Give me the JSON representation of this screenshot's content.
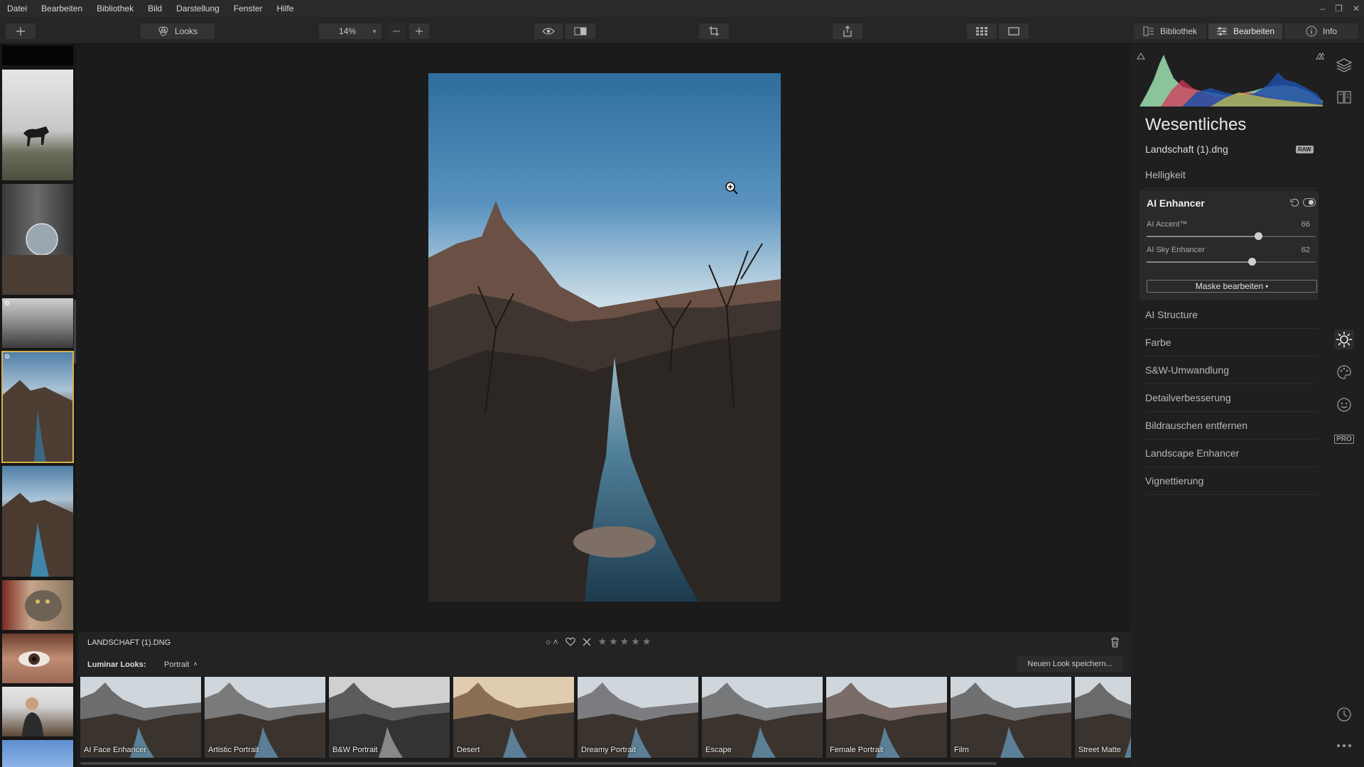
{
  "menu": [
    "Datei",
    "Bearbeiten",
    "Bibliothek",
    "Bild",
    "Darstellung",
    "Fenster",
    "Hilfe"
  ],
  "toolbar": {
    "looks_label": "Looks",
    "zoom_value": "14%",
    "tab_library": "Bibliothek",
    "tab_edit": "Bearbeiten",
    "tab_info": "Info"
  },
  "image": {
    "filename_caps": "LANDSCHAFT (1).DNG"
  },
  "looks": {
    "label": "Luminar Looks:",
    "category": "Portrait",
    "save_button": "Neuen Look speichern...",
    "items": [
      "AI Face Enhancer",
      "Artistic Portrait",
      "B&W Portrait",
      "Desert",
      "Dreamy Portrait",
      "Escape",
      "Female Portrait",
      "Film",
      "Street Matte"
    ]
  },
  "panel": {
    "title": "Wesentliches",
    "filename": "Landschaft (1).dng",
    "raw_badge": "RAW",
    "helligkeit": "Helligkeit",
    "ai_enhancer": {
      "title": "AI Enhancer",
      "accent_label": "AI Accent™",
      "accent_value": "66",
      "accent_fraction": 0.66,
      "sky_label": "AI Sky Enhancer",
      "sky_value": "62",
      "sky_fraction": 0.62,
      "mask_button": "Maske bearbeiten"
    },
    "sections": [
      "AI Structure",
      "Farbe",
      "S&W-Umwandlung",
      "Detailverbesserung",
      "Bildrauschen entfernen",
      "Landscape Enhancer",
      "Vignettierung"
    ]
  },
  "rail": {
    "pro_badge": "PRO"
  },
  "icons": [
    "plus-icon",
    "looks-icon",
    "minus-icon",
    "eye-icon",
    "compare-icon",
    "crop-icon",
    "share-icon",
    "grid-icon",
    "single-view-icon",
    "library-icon",
    "sliders-icon",
    "info-icon",
    "layers-icon",
    "canvas-icon",
    "sun-icon",
    "palette-icon",
    "face-icon",
    "history-icon",
    "more-icon",
    "trash-icon",
    "heart-icon",
    "reject-icon",
    "star-icon",
    "zoom-in-icon",
    "reset-icon",
    "visibility-toggle-icon"
  ],
  "colors": {
    "accent_selection": "#d8b24a"
  }
}
